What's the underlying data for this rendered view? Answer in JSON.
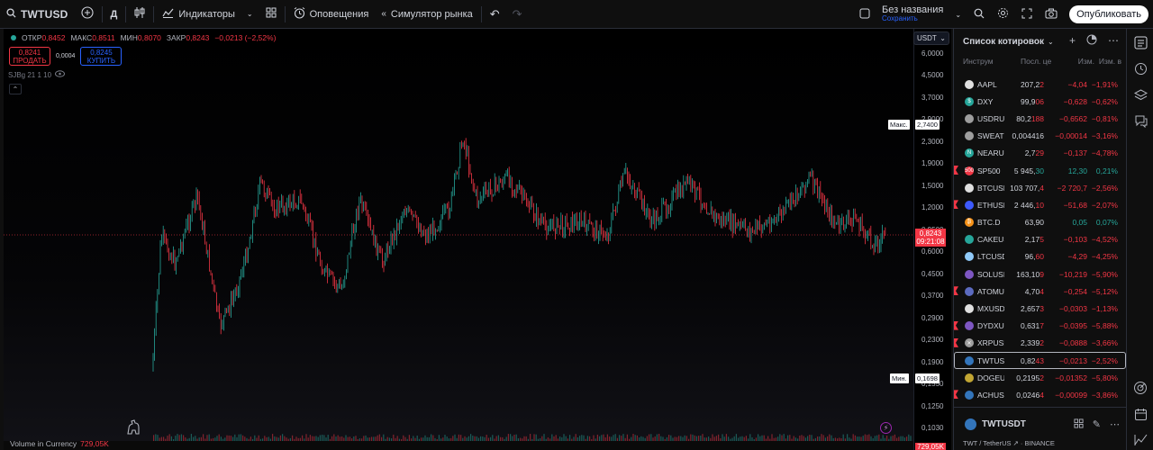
{
  "topbar": {
    "symbol": "TWTUSD",
    "interval": "Д",
    "indicators": "Индикаторы",
    "alerts": "Оповещения",
    "replay": "Симулятор рынка",
    "layout_name": "Без названия",
    "layout_status": "Сохранить",
    "publish": "Опубликовать"
  },
  "legend": {
    "open_label": "ОТКР",
    "open": "0,8452",
    "high_label": "МАКС",
    "high": "0,8511",
    "low_label": "МИН",
    "low": "0,8070",
    "close_label": "ЗАКР",
    "close": "0,8243",
    "change": "−0,0213 (−2,52%)"
  },
  "trade": {
    "sell_price": "0,8241",
    "sell_label": "ПРОДАТЬ",
    "spread": "0,0004",
    "buy_price": "0,8245",
    "buy_label": "КУПИТЬ"
  },
  "study_label": "SJBg 21 1 10",
  "currency": "USDT",
  "scale_ticks": [
    "6,0000",
    "4,5000",
    "3,7000",
    "2,9000",
    "2,3000",
    "1,9000",
    "1,5000",
    "1,2000",
    "0,9500",
    "0,6000",
    "0,4500",
    "0,3700",
    "0,2900",
    "0,2300",
    "0,1900",
    "0,1550",
    "0,1250",
    "0,1030"
  ],
  "max_label": "Макс.",
  "max_value": "2,7400",
  "min_label": "Мин.",
  "min_value": "0,1698",
  "last_price": "0,8243",
  "countdown": "09:21:08",
  "volume": {
    "label": "Volume in Currency",
    "value": "729,05K",
    "tag": "729,05K"
  },
  "colors": {
    "up": "#26a69a",
    "down": "#f23645",
    "accent": "#2962ff"
  },
  "watchlist": {
    "title": "Список котировок",
    "columns": [
      "Инструм",
      "Посл. це",
      "Изм.",
      "Изм. в"
    ],
    "rows": [
      {
        "sym": "AAPL",
        "last": "207,2",
        "last_tail": "2",
        "chg": "−4,04",
        "pct": "−1,91%",
        "dir": "neg",
        "flag": false,
        "icon": "#e0e0e0",
        "glyph": ""
      },
      {
        "sym": "DXY",
        "last": "99,9",
        "last_tail": "06",
        "chg": "−0,628",
        "pct": "−0,62%",
        "dir": "neg",
        "flag": false,
        "icon": "#26a69a",
        "glyph": "$"
      },
      {
        "sym": "USDRUB",
        "last": "80,2",
        "last_tail": "188",
        "chg": "−0,6562",
        "pct": "−0,81%",
        "dir": "neg",
        "flag": false,
        "icon": "#9e9e9e",
        "glyph": ""
      },
      {
        "sym": "SWEATUSDT",
        "last": "0,004416",
        "last_tail": "",
        "chg": "−0,00014",
        "pct": "−3,16%",
        "dir": "neg",
        "flag": false,
        "icon": "#9e9e9e",
        "glyph": ""
      },
      {
        "sym": "NEARUSD",
        "last": "2,7",
        "last_tail": "29",
        "chg": "−0,137",
        "pct": "−4,78%",
        "dir": "neg",
        "flag": false,
        "icon": "#26a69a",
        "glyph": "N"
      },
      {
        "sym": "SP500",
        "last": "5 945,",
        "last_tail": "30",
        "chg": "12,30",
        "pct": "0,21%",
        "dir": "pos",
        "flag": true,
        "icon": "#f23645",
        "glyph": "500"
      },
      {
        "sym": "BTCUSD",
        "last": "103 707,",
        "last_tail": "4",
        "chg": "−2 720,7",
        "pct": "−2,56%",
        "dir": "neg",
        "flag": false,
        "icon": "#e0e0e0",
        "glyph": ""
      },
      {
        "sym": "ETHUSD",
        "last": "2 446,",
        "last_tail": "10",
        "chg": "−51,68",
        "pct": "−2,07%",
        "dir": "neg",
        "flag": true,
        "icon": "#3d5afe",
        "glyph": ""
      },
      {
        "sym": "BTC.D",
        "last": "63,90",
        "last_tail": "",
        "chg": "0,05",
        "pct": "0,07%",
        "dir": "pos",
        "flag": false,
        "icon": "#f7931a",
        "glyph": "₿"
      },
      {
        "sym": "CAKEUSD",
        "last": "2,17",
        "last_tail": "5",
        "chg": "−0,103",
        "pct": "−4,52%",
        "dir": "neg",
        "flag": false,
        "icon": "#26a69a",
        "glyph": ""
      },
      {
        "sym": "LTCUSD",
        "last": "96,",
        "last_tail": "60",
        "chg": "−4,29",
        "pct": "−4,25%",
        "dir": "neg",
        "flag": false,
        "icon": "#90caf9",
        "glyph": ""
      },
      {
        "sym": "SOLUSD",
        "last": "163,10",
        "last_tail": "9",
        "chg": "−10,219",
        "pct": "−5,90%",
        "dir": "neg",
        "flag": false,
        "icon": "#7e57c2",
        "glyph": ""
      },
      {
        "sym": "ATOMUSD",
        "last": "4,70",
        "last_tail": "4",
        "chg": "−0,254",
        "pct": "−5,12%",
        "dir": "neg",
        "flag": true,
        "icon": "#5c6bc0",
        "glyph": ""
      },
      {
        "sym": "MXUSDT",
        "last": "2,657",
        "last_tail": "3",
        "chg": "−0,0303",
        "pct": "−1,13%",
        "dir": "neg",
        "flag": false,
        "icon": "#e0e0e0",
        "glyph": ""
      },
      {
        "sym": "DYDXUSD",
        "last": "0,631",
        "last_tail": "7",
        "chg": "−0,0395",
        "pct": "−5,88%",
        "dir": "neg",
        "flag": true,
        "icon": "#7e57c2",
        "glyph": ""
      },
      {
        "sym": "XRPUSD",
        "last": "2,339",
        "last_tail": "2",
        "chg": "−0,0888",
        "pct": "−3,66%",
        "dir": "neg",
        "flag": true,
        "icon": "#9e9e9e",
        "glyph": "✕"
      },
      {
        "sym": "TWTUSDT",
        "last": "0,82",
        "last_tail": "43",
        "chg": "−0,0213",
        "pct": "−2,52%",
        "dir": "neg",
        "flag": false,
        "icon": "#3375bb",
        "glyph": "",
        "selected": true
      },
      {
        "sym": "DOGEUSD",
        "last": "0,2195",
        "last_tail": "2",
        "chg": "−0,01352",
        "pct": "−5,80%",
        "dir": "neg",
        "flag": false,
        "icon": "#c2a633",
        "glyph": ""
      },
      {
        "sym": "ACHUSD",
        "last": "0,0246",
        "last_tail": "4",
        "chg": "−0,00099",
        "pct": "−3,86%",
        "dir": "neg",
        "flag": true,
        "icon": "#3375bb",
        "glyph": ""
      }
    ]
  },
  "details": {
    "symbol": "TWTUSDT",
    "subtitle": "TWT / TetherUS ↗ · BINANCE"
  }
}
